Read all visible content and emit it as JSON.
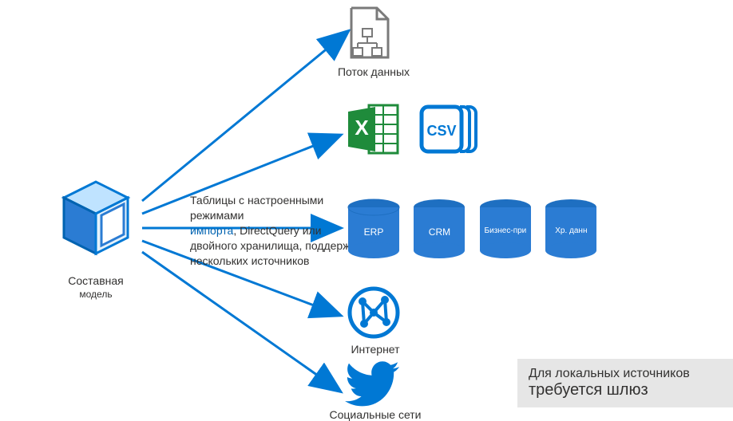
{
  "diagram": {
    "source_label_line1": "Составная",
    "source_label_line2": "модель",
    "center_text_line1": "Таблицы с настроенными режимами",
    "center_text_line2a": "импорта",
    "center_text_line2b": ", DirectQuery или",
    "center_text_line3": "двойного хранилища, поддержка",
    "center_text_line4": "нескольких источников",
    "targets": {
      "dataflow": "Поток данных",
      "internet": "Интернет",
      "social": "Социальные сети"
    },
    "file_types": {
      "csv": "CSV"
    },
    "databases": [
      {
        "label": "ERP"
      },
      {
        "label": "CRM"
      },
      {
        "label": "Бизнес-при"
      },
      {
        "label": "Хр. данн"
      }
    ],
    "note": {
      "line1": "Для локальных источников",
      "line2": "требуется шлюз"
    },
    "colors": {
      "primary": "#0078d4",
      "excel": "#1f8b3b",
      "gray": "#7a7a7a"
    }
  }
}
